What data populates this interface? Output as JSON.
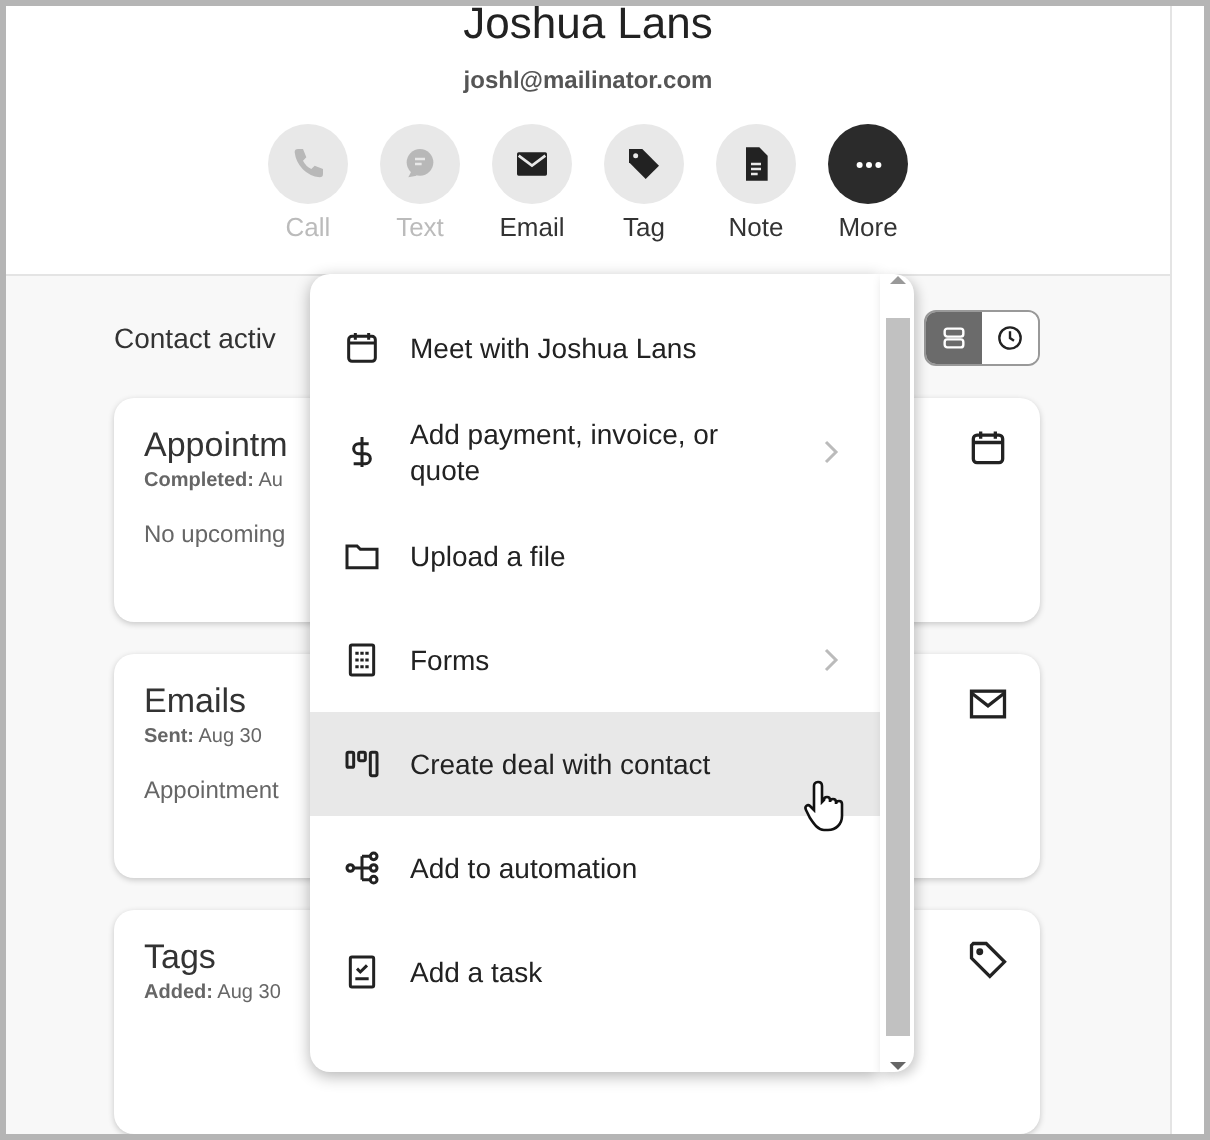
{
  "contact": {
    "name": "Joshua Lans",
    "email": "joshl@mailinator.com"
  },
  "actions": [
    {
      "kind": "call",
      "label": "Call",
      "disabled": true,
      "selected": false
    },
    {
      "kind": "text",
      "label": "Text",
      "disabled": true,
      "selected": false
    },
    {
      "kind": "email",
      "label": "Email",
      "disabled": false,
      "selected": false
    },
    {
      "kind": "tag",
      "label": "Tag",
      "disabled": false,
      "selected": false
    },
    {
      "kind": "note",
      "label": "Note",
      "disabled": false,
      "selected": false
    },
    {
      "kind": "more",
      "label": "More",
      "disabled": false,
      "selected": true
    }
  ],
  "activity": {
    "title": "Contact activ",
    "views": [
      {
        "kind": "list",
        "selected": true
      },
      {
        "kind": "clock",
        "selected": false
      }
    ],
    "cards": [
      {
        "kind": "calendar",
        "title": "Appointm",
        "meta_label": "Completed:",
        "meta_value": "Au",
        "body": "No upcoming"
      },
      {
        "kind": "mail",
        "title": "Emails",
        "meta_label": "Sent:",
        "meta_value": "Aug 30",
        "body": "Appointment"
      },
      {
        "kind": "tag",
        "title": "Tags",
        "meta_label": "Added:",
        "meta_value": "Aug 30"
      }
    ]
  },
  "menu": {
    "items": [
      {
        "kind": "calendar",
        "label": "Meet with Joshua Lans",
        "submenu": false,
        "selected": false
      },
      {
        "kind": "dollar",
        "label": "Add payment, invoice, or quote",
        "submenu": true,
        "selected": false
      },
      {
        "kind": "folder",
        "label": "Upload a file",
        "submenu": false,
        "selected": false
      },
      {
        "kind": "form",
        "label": "Forms",
        "submenu": true,
        "selected": false
      },
      {
        "kind": "deal",
        "label": "Create deal with contact",
        "submenu": false,
        "selected": true
      },
      {
        "kind": "automation",
        "label": "Add to automation",
        "submenu": false,
        "selected": false
      },
      {
        "kind": "task",
        "label": "Add a task",
        "submenu": false,
        "selected": false
      }
    ]
  }
}
